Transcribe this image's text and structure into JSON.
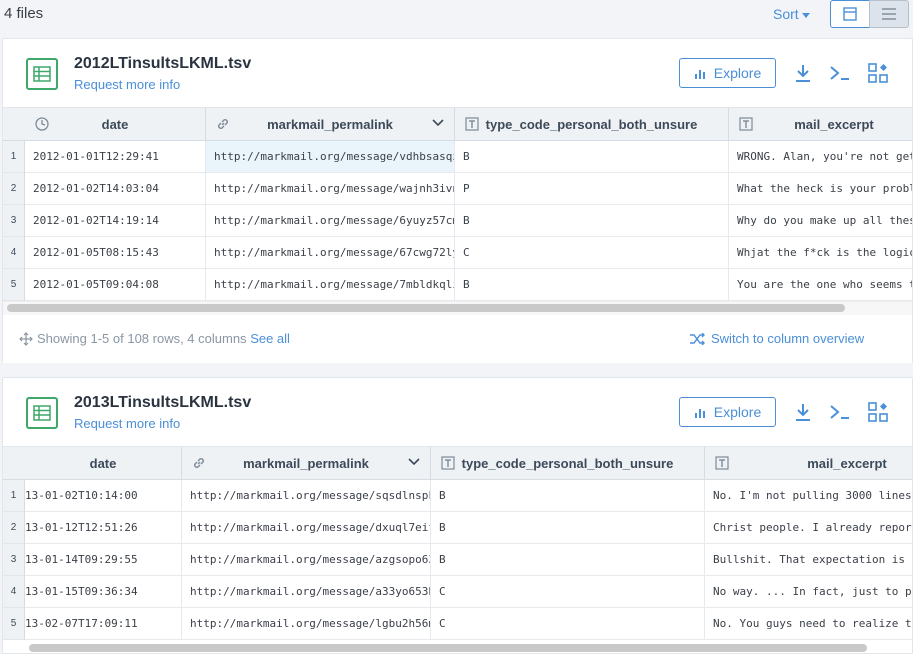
{
  "header": {
    "files_count": "4 files",
    "sort_label": "Sort"
  },
  "files": [
    {
      "name": "2012LTinsultsLKML.tsv",
      "request_info": "Request more info",
      "explore_label": "Explore",
      "columns": [
        "date",
        "markmail_permalink",
        "type_code_personal_both_unsure",
        "mail_excerpt"
      ],
      "rows": [
        [
          "2012-01-01T12:29:41",
          "http://markmail.org/message/vdhbsasqz",
          "B",
          "WRONG. Alan, you're not get"
        ],
        [
          "2012-01-02T14:03:04",
          "http://markmail.org/message/wajnh3ivn",
          "P",
          "What the heck is your probl"
        ],
        [
          "2012-01-02T14:19:14",
          "http://markmail.org/message/6yuyz57cm",
          "B",
          "Why do you make up all thes"
        ],
        [
          "2012-01-05T08:15:43",
          "http://markmail.org/message/67cwg72ly",
          "C",
          "Whjat the f*ck is the logic"
        ],
        [
          "2012-01-05T09:04:08",
          "http://markmail.org/message/7mbldkqli",
          "B",
          "You are the one who seems t"
        ]
      ],
      "row_numbers": [
        "1",
        "2",
        "3",
        "4",
        "5"
      ],
      "footer_text": "Showing 1-5 of 108 rows, 4 columns",
      "see_all": "See all",
      "switch_label": "Switch to column overview"
    },
    {
      "name": "2013LTinsultsLKML.tsv",
      "request_info": "Request more info",
      "explore_label": "Explore",
      "columns": [
        "date",
        "markmail_permalink",
        "type_code_personal_both_unsure",
        "mail_excerpt"
      ],
      "rows": [
        [
          "13-01-02T10:14:00",
          "http://markmail.org/message/sqsdlnspk",
          "B",
          "No. I'm not pulling 3000 lines"
        ],
        [
          "13-01-12T12:51:26",
          "http://markmail.org/message/dxuql7eif",
          "B",
          "Christ people. I already report"
        ],
        [
          "13-01-14T09:29:55",
          "http://markmail.org/message/azgsopo63",
          "B",
          "Bullshit. That expectation is j"
        ],
        [
          "13-01-15T09:36:34",
          "http://markmail.org/message/a33yo653h",
          "C",
          "No way. ... In fact, just to pr"
        ],
        [
          "13-02-07T17:09:11",
          "http://markmail.org/message/lgbu2h56m",
          "C",
          "No. You guys need to realize th"
        ]
      ],
      "row_numbers": [
        "1",
        "2",
        "3",
        "4",
        "5"
      ]
    }
  ]
}
